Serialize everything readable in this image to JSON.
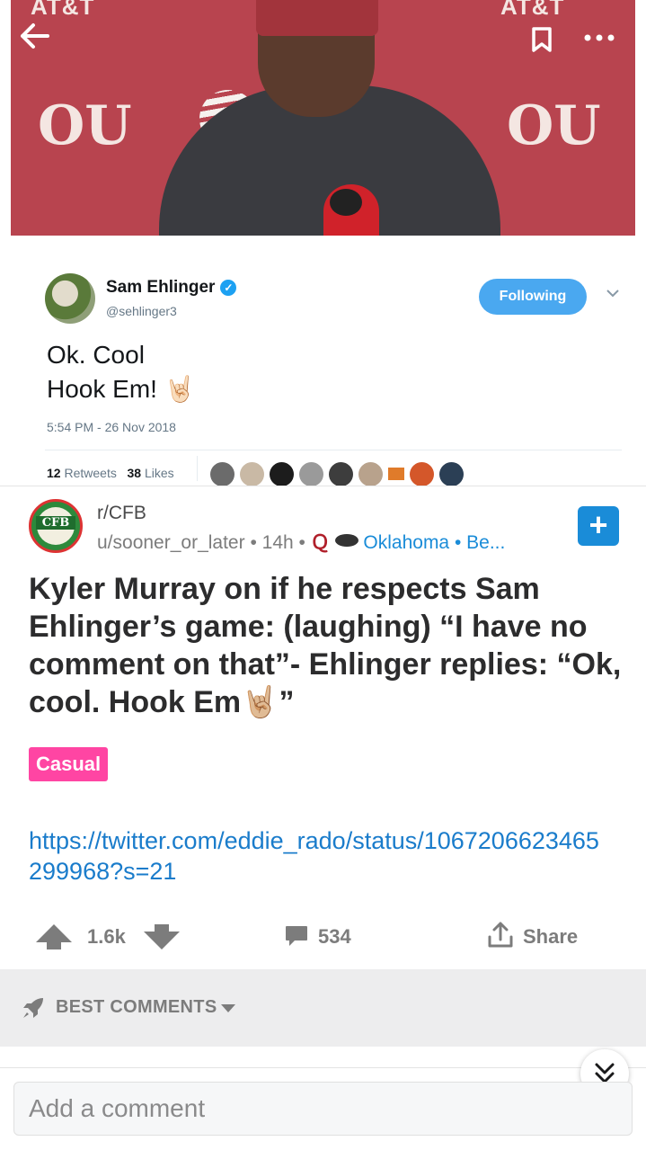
{
  "media": {
    "backdrop_text_left": "AT&T",
    "backdrop_text_right": "AT&T",
    "logo_text": "OU"
  },
  "top_bar": {
    "back_icon": "arrow-left-icon",
    "bookmark_icon": "bookmark-icon",
    "more_icon": "more-dots-icon"
  },
  "tweet": {
    "name": "Sam Ehlinger",
    "handle": "@sehlinger3",
    "follow_label": "Following",
    "text_line1": "Ok. Cool",
    "text_line2": "Hook Em! 🤘🏻",
    "timestamp": "5:54 PM - 26 Nov 2018",
    "retweets_count": "12",
    "retweets_label": "Retweets",
    "likes_count": "38",
    "likes_label": "Likes"
  },
  "post": {
    "subreddit": "r/CFB",
    "subreddit_icon_text": "CFB",
    "author": "u/sooner_or_later",
    "age": "14h",
    "flair_text": "Oklahoma • Be...",
    "title": "Kyler Murray on if he respects Sam Ehlinger’s game: (laughing) “I have no comment on that”- Ehlinger replies: “Ok, cool. Hook Em🤘🏼”",
    "flair": "Casual",
    "link": "https://twitter.com/eddie_rado/status/1067206623465299968?s=21"
  },
  "actions": {
    "score": "1.6k",
    "comments": "534",
    "share_label": "Share"
  },
  "comments": {
    "sort_label": "BEST COMMENTS",
    "input_placeholder": "Add a comment"
  },
  "colors": {
    "link_blue": "#1a7ccb",
    "flair_pink": "#ff45a3",
    "twitter_blue": "#4aa8f0",
    "join_blue": "#1a8cd8"
  }
}
